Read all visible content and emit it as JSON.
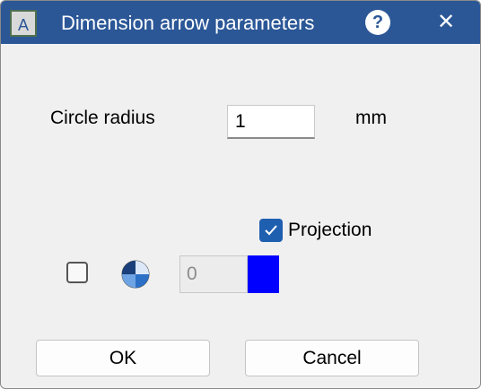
{
  "window": {
    "title": "Dimension arrow parameters",
    "help_label": "?",
    "close_label": "✕",
    "app_icon_letter": "A",
    "titlebar_color": "#2b5797"
  },
  "form": {
    "radius_label": "Circle radius",
    "radius_value": "1",
    "radius_unit": "mm",
    "projection_label": "Projection",
    "projection_checked": true,
    "second_checkbox_checked": false,
    "number_value": "0",
    "color_swatch": "#0000ff"
  },
  "buttons": {
    "ok": "OK",
    "cancel": "Cancel"
  }
}
